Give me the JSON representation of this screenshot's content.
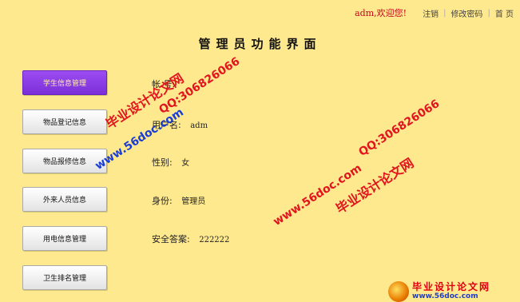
{
  "header": {
    "welcome": "adm,欢迎您!",
    "links": [
      "注销",
      "修改密码",
      "首 页"
    ],
    "separators": [
      "|",
      "|"
    ]
  },
  "page_title": "管理员功能界面",
  "menu": [
    {
      "label": "学生信息管理",
      "active": true
    },
    {
      "label": "物品登记信息",
      "active": false
    },
    {
      "label": "物品报修信息",
      "active": false
    },
    {
      "label": "外来人员信息",
      "active": false
    },
    {
      "label": "用电信息管理",
      "active": false
    },
    {
      "label": "卫生排名管理",
      "active": false
    }
  ],
  "info": {
    "row1_label": "帐 号:",
    "row2_label": "用户名:",
    "row2_value": "adm",
    "row3_label": "性别:",
    "row3_value": "女",
    "row4_label": "身份:",
    "row4_value": "管理员",
    "row5_label": "安全答案:",
    "row5_value": "222222"
  },
  "watermarks": {
    "w1_cn": "毕业设计论文网",
    "w1_url": "www.56doc.com",
    "w1_qq": "QQ:306826066",
    "w2_qq": "QQ:306826066",
    "w2_url": "www.56doc.com",
    "w2_cn": "毕业设计论文网"
  },
  "logo": {
    "name": "毕业设计论文网",
    "url": "www.56doc.com",
    "icon": "globe-logo-icon"
  },
  "colors": {
    "background": "#ffe98f",
    "active_menu": "#8a3ce6",
    "welcome": "#c8001e",
    "watermark_red": "#e2141e",
    "watermark_blue": "#1a3dd6"
  }
}
